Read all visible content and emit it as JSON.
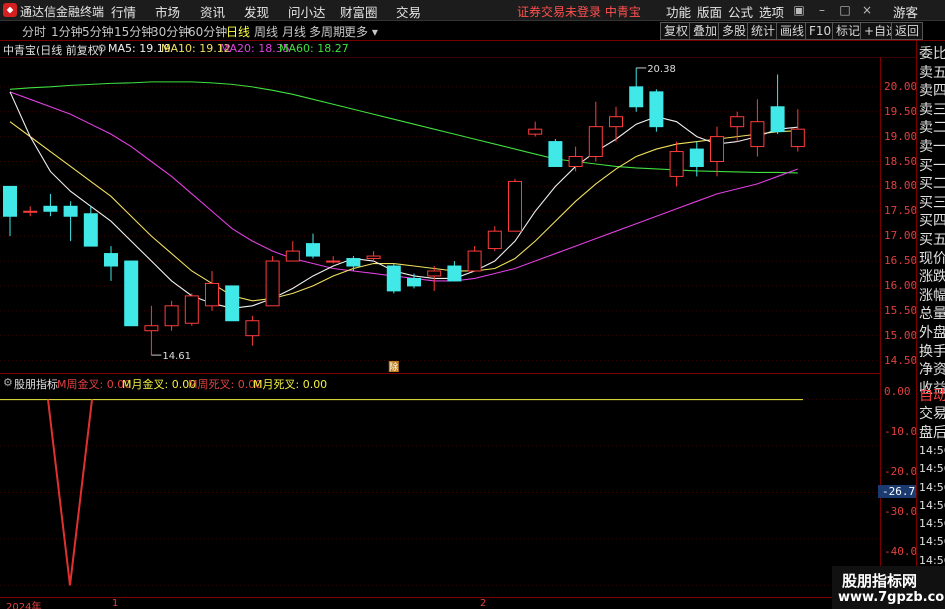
{
  "app": {
    "name": "通达信金融终端",
    "menus": [
      "行情",
      "市场",
      "资讯",
      "发现",
      "问小达",
      "财富圈",
      "交易"
    ],
    "warning": "证券交易未登录  中青宝",
    "right_menus": [
      "功能",
      "版面",
      "公式",
      "选项"
    ],
    "guest": "游客"
  },
  "tabs": {
    "periods": [
      "分时",
      "1分钟",
      "5分钟",
      "15分钟",
      "30分钟",
      "60分钟",
      "日线",
      "周线",
      "月线",
      "多周期",
      "更多"
    ],
    "active": "日线",
    "right_buttons": [
      "复权",
      "叠加",
      "多股",
      "统计",
      "画线",
      "F10",
      "标记",
      "+自选",
      "返回"
    ]
  },
  "chart_info": {
    "title": "中青宝(日线 前复权)",
    "ma5": "MA5: 19.19",
    "ma10": "MA10: 19.12",
    "ma20": "MA20: 18.35",
    "ma60": "MA60: 18.27",
    "high_label": "20.38",
    "low_label": "14.61",
    "marker": "除"
  },
  "sidebar": {
    "items": [
      "委比",
      "卖五",
      "卖四",
      "卖三",
      "卖二",
      "卖一",
      "买一",
      "买二",
      "买三",
      "买四",
      "买五",
      "现价",
      "涨跌",
      "涨幅",
      "总量",
      "外盘",
      "换手",
      "净资",
      "收益",
      "自动",
      "交易",
      "盘后",
      "14:56",
      "14:56",
      "14:56",
      "14:56",
      "14:56",
      "14:56",
      "14:56",
      "14:56"
    ]
  },
  "indicator": {
    "name": "股朋指标",
    "fields": [
      "M周金叉: 0.00",
      "M月金叉: 0.00",
      "M周死叉: 0.00",
      "M月死叉: 0.00"
    ],
    "axis": [
      "0.00",
      "-10.00",
      "-20.00",
      "-26.75",
      "-30.00",
      "-40.00"
    ]
  },
  "bottom_axis": {
    "year": "2024年",
    "m1": "1",
    "m2": "2"
  },
  "watermark": {
    "line1": "股朋指标网",
    "line2": "www.7gpzb.com"
  },
  "chart_data": {
    "type": "candlestick",
    "y_axis_ticks": [
      "20.00",
      "19.50",
      "19.00",
      "18.50",
      "18.00",
      "17.50",
      "17.00",
      "16.50",
      "16.00",
      "15.50",
      "15.00",
      "14.50"
    ],
    "ylim": [
      14.25,
      20.6
    ],
    "candles": [
      {
        "o": 18.0,
        "c": 17.4,
        "h": 18.0,
        "l": 17.0
      },
      {
        "o": 17.5,
        "c": 17.5,
        "h": 17.6,
        "l": 17.4
      },
      {
        "o": 17.6,
        "c": 17.5,
        "h": 17.85,
        "l": 17.4
      },
      {
        "o": 17.6,
        "c": 17.4,
        "h": 17.7,
        "l": 16.9
      },
      {
        "o": 17.45,
        "c": 16.8,
        "h": 17.6,
        "l": 16.8
      },
      {
        "o": 16.65,
        "c": 16.4,
        "h": 16.8,
        "l": 16.1
      },
      {
        "o": 16.5,
        "c": 15.2,
        "h": 16.5,
        "l": 15.2
      },
      {
        "o": 15.1,
        "c": 15.2,
        "h": 15.6,
        "l": 14.61
      },
      {
        "o": 15.2,
        "c": 15.6,
        "h": 15.7,
        "l": 15.1
      },
      {
        "o": 15.25,
        "c": 15.8,
        "h": 15.85,
        "l": 15.2
      },
      {
        "o": 15.6,
        "c": 16.05,
        "h": 16.3,
        "l": 15.5
      },
      {
        "o": 16.0,
        "c": 15.3,
        "h": 16.0,
        "l": 15.3
      },
      {
        "o": 15.0,
        "c": 15.3,
        "h": 15.4,
        "l": 14.8
      },
      {
        "o": 15.6,
        "c": 16.5,
        "h": 16.6,
        "l": 15.6
      },
      {
        "o": 16.5,
        "c": 16.7,
        "h": 16.9,
        "l": 16.5
      },
      {
        "o": 16.85,
        "c": 16.6,
        "h": 17.05,
        "l": 16.55
      },
      {
        "o": 16.5,
        "c": 16.5,
        "h": 16.6,
        "l": 16.45
      },
      {
        "o": 16.55,
        "c": 16.4,
        "h": 16.6,
        "l": 16.3
      },
      {
        "o": 16.55,
        "c": 16.6,
        "h": 16.7,
        "l": 16.5
      },
      {
        "o": 16.4,
        "c": 15.9,
        "h": 16.45,
        "l": 15.85
      },
      {
        "o": 16.15,
        "c": 16.0,
        "h": 16.25,
        "l": 15.95
      },
      {
        "o": 16.2,
        "c": 16.3,
        "h": 16.4,
        "l": 15.9
      },
      {
        "o": 16.4,
        "c": 16.1,
        "h": 16.5,
        "l": 16.1
      },
      {
        "o": 16.3,
        "c": 16.7,
        "h": 16.8,
        "l": 16.3
      },
      {
        "o": 16.75,
        "c": 17.1,
        "h": 17.2,
        "l": 16.7
      },
      {
        "o": 17.1,
        "c": 18.1,
        "h": 18.15,
        "l": 17.1
      },
      {
        "o": 19.05,
        "c": 19.15,
        "h": 19.3,
        "l": 19.0
      },
      {
        "o": 18.9,
        "c": 18.4,
        "h": 18.95,
        "l": 18.4
      },
      {
        "o": 18.4,
        "c": 18.6,
        "h": 18.8,
        "l": 18.3
      },
      {
        "o": 18.6,
        "c": 19.2,
        "h": 19.7,
        "l": 18.5
      },
      {
        "o": 19.2,
        "c": 19.4,
        "h": 19.6,
        "l": 18.9
      },
      {
        "o": 20.0,
        "c": 19.6,
        "h": 20.38,
        "l": 19.5
      },
      {
        "o": 19.9,
        "c": 19.2,
        "h": 19.95,
        "l": 19.1
      },
      {
        "o": 18.2,
        "c": 18.7,
        "h": 18.9,
        "l": 18.0
      },
      {
        "o": 18.75,
        "c": 18.4,
        "h": 18.9,
        "l": 18.2
      },
      {
        "o": 18.5,
        "c": 19.0,
        "h": 19.2,
        "l": 18.2
      },
      {
        "o": 19.2,
        "c": 19.4,
        "h": 19.5,
        "l": 18.9
      },
      {
        "o": 18.8,
        "c": 19.3,
        "h": 19.75,
        "l": 18.6
      },
      {
        "o": 19.6,
        "c": 19.1,
        "h": 20.25,
        "l": 19.05
      },
      {
        "o": 18.8,
        "c": 19.15,
        "h": 19.55,
        "l": 18.7
      }
    ],
    "ma5": [
      19.9,
      19.0,
      18.3,
      17.9,
      17.6,
      17.3,
      16.9,
      16.5,
      16.1,
      15.8,
      15.65,
      15.55,
      15.6,
      15.75,
      15.95,
      16.2,
      16.4,
      16.55,
      16.5,
      16.3,
      16.2,
      16.15,
      16.15,
      16.3,
      16.5,
      16.9,
      17.5,
      18.0,
      18.4,
      18.7,
      18.95,
      19.25,
      19.4,
      19.3,
      19.0,
      18.85,
      18.9,
      19.0,
      19.15,
      19.19
    ],
    "ma10": [
      19.3,
      19.0,
      18.7,
      18.4,
      18.1,
      17.8,
      17.4,
      17.0,
      16.65,
      16.3,
      16.05,
      15.8,
      15.7,
      15.75,
      15.85,
      16.0,
      16.2,
      16.35,
      16.45,
      16.45,
      16.4,
      16.35,
      16.3,
      16.3,
      16.35,
      16.55,
      16.9,
      17.3,
      17.7,
      18.05,
      18.35,
      18.6,
      18.75,
      18.85,
      18.9,
      18.95,
      19.0,
      19.05,
      19.1,
      19.12
    ],
    "ma20": [
      19.9,
      19.75,
      19.6,
      19.45,
      19.25,
      19.05,
      18.8,
      18.5,
      18.2,
      17.85,
      17.5,
      17.15,
      16.9,
      16.7,
      16.55,
      16.45,
      16.35,
      16.3,
      16.25,
      16.2,
      16.15,
      16.1,
      16.1,
      16.15,
      16.25,
      16.35,
      16.5,
      16.65,
      16.8,
      16.95,
      17.1,
      17.25,
      17.4,
      17.55,
      17.7,
      17.85,
      17.95,
      18.05,
      18.2,
      18.35
    ],
    "ma60": [
      19.95,
      19.98,
      20.0,
      20.03,
      20.05,
      20.07,
      20.08,
      20.1,
      20.1,
      20.1,
      20.08,
      20.05,
      20.0,
      19.93,
      19.85,
      19.75,
      19.65,
      19.55,
      19.45,
      19.35,
      19.25,
      19.15,
      19.05,
      18.95,
      18.85,
      18.75,
      18.65,
      18.55,
      18.5,
      18.45,
      18.4,
      18.37,
      18.35,
      18.33,
      18.31,
      18.3,
      18.29,
      18.28,
      18.28,
      18.27
    ],
    "indicator_series": [
      0,
      0,
      0,
      0,
      -40,
      0,
      0,
      0,
      0,
      0,
      0,
      0,
      0,
      0,
      0,
      0,
      0,
      0,
      0,
      0,
      0,
      0,
      0,
      0,
      0,
      0,
      0,
      0,
      0,
      0,
      0,
      0,
      0,
      0,
      0,
      0,
      0,
      0,
      0,
      0
    ],
    "indicator_ylim": [
      -42.5,
      2.5
    ],
    "colors": {
      "up": "#ff3c3c",
      "down": "#40e8e8",
      "ma5": "#f0f0f0",
      "ma10": "#f0e060",
      "ma20": "#e040e0",
      "ma60": "#40e040",
      "indicator": "#e03030",
      "zero_line": "#f0f040"
    }
  }
}
